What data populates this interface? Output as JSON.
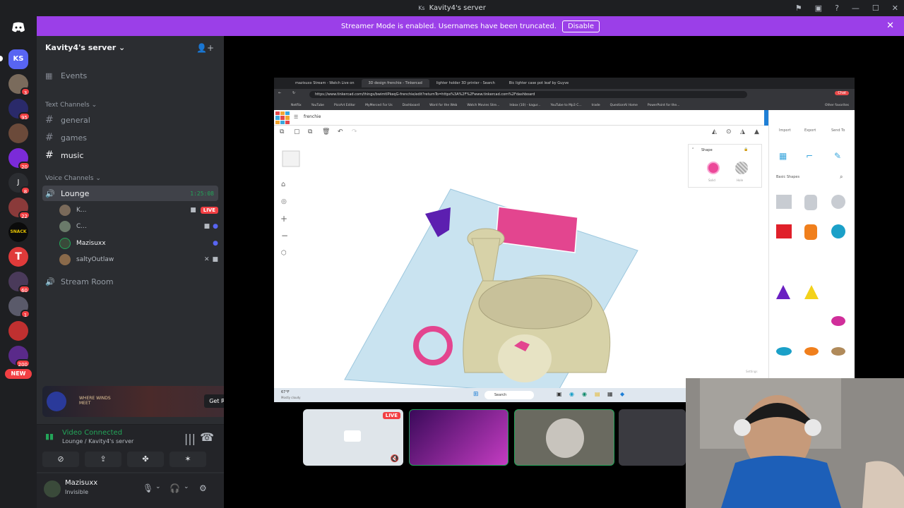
{
  "window": {
    "title": "Kavity4's server",
    "icon_text": "Ks"
  },
  "banner": {
    "message": "Streamer Mode is enabled. Usernames have been truncated.",
    "disable_label": "Disable"
  },
  "rail": {
    "badges": [
      "3",
      "95",
      "20",
      "8",
      "22",
      "60",
      "1",
      "200"
    ],
    "new_label": "NEW",
    "server_initials": "KS"
  },
  "sidebar": {
    "server_name": "Kavity4's server",
    "events_label": "Events",
    "text_category": "Text Channels",
    "text_channels": [
      "general",
      "games",
      "music"
    ],
    "voice_category": "Voice Channels",
    "voice_channels": {
      "lounge": "Lounge",
      "lounge_timer": "1:25:08",
      "stream_room": "Stream Room"
    },
    "voice_users": [
      {
        "name": "K...",
        "live": "LIVE"
      },
      {
        "name": "C..."
      },
      {
        "name": "Mazisuxx"
      },
      {
        "name": "saltyOutlaw"
      }
    ]
  },
  "promo": {
    "logo_text": "WHERE WINDS MEET",
    "button_label": "Get Reward!"
  },
  "voice_connection": {
    "title": "Video Connected",
    "subtitle": "Lounge / Kavity4's server"
  },
  "user": {
    "name": "Mazisuxx",
    "status": "Invisible"
  },
  "shared_screen": {
    "tabs": [
      "mazisuxx Stream - Watch Live on",
      "3D design frenchie - Tinkercad",
      "lighter holder 3D printer - Search",
      "Bic lighter case pot leaf by Guyve"
    ],
    "url": "https://www.tinkercad.com/things/bwimtIPkeqG-frenchie/edit?returnTo=https%3A%2F%2Fwww.tinkercad.com%2Fdashboard",
    "bookmarks": [
      "Netflix",
      "YouTube",
      "PicsArt Editor",
      "MyMerced For Us",
      "Dashboard",
      "Word for the Web",
      "Watch Movies Stre...",
      "Inbox (10) - kagur...",
      "YouTube to Mp3 C...",
      "trade",
      "QuestionAI Home",
      "PowerPoint for the..."
    ],
    "all_favorites": "Other favorites",
    "chat_label": "Chat",
    "design_name": "frenchie",
    "tc_actions": [
      "Import",
      "Export",
      "Send To"
    ],
    "shape_panel": {
      "title": "Shape",
      "solid": "Solid",
      "hole": "Hole"
    },
    "library_label": "Basic Shapes",
    "settings_label": "Settings",
    "taskbar": {
      "weather_temp": "67°F",
      "weather_desc": "Mostly cloudy",
      "search": "Search"
    }
  },
  "thumbnails": {
    "live_label": "LIVE"
  }
}
